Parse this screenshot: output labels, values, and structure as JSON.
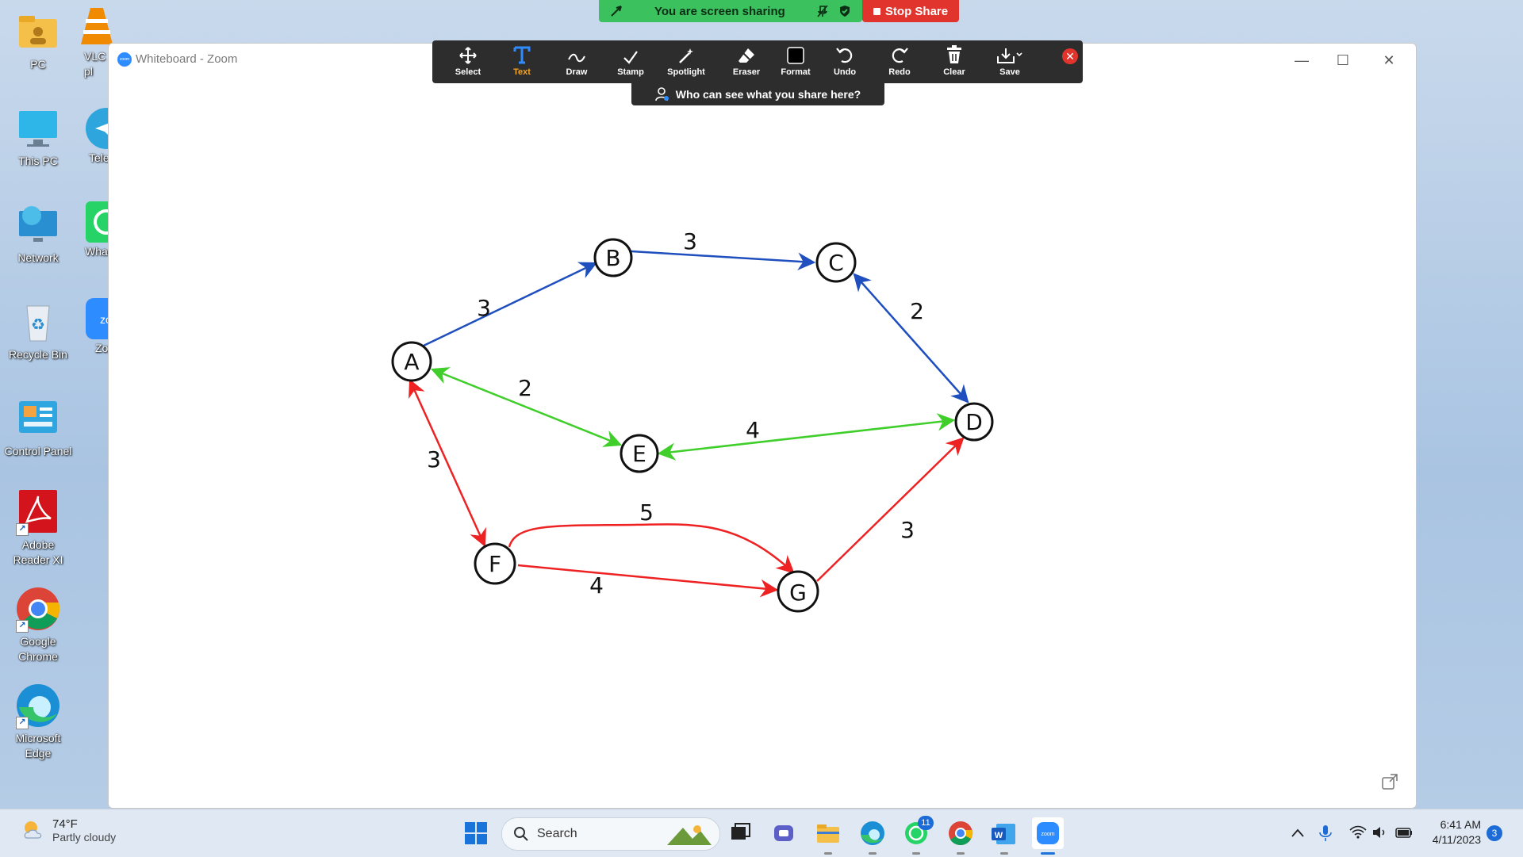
{
  "desktop": {
    "icons": [
      {
        "label": "PC"
      },
      {
        "label": "This PC"
      },
      {
        "label": "Network"
      },
      {
        "label": "Recycle Bin"
      },
      {
        "label": "Control Panel"
      },
      {
        "label": "Adobe Reader XI"
      },
      {
        "label": "Google Chrome"
      },
      {
        "label": "Microsoft Edge"
      }
    ],
    "partial_icons": [
      {
        "label": "VLC pl"
      },
      {
        "label": "Tele"
      },
      {
        "label": "Wha"
      },
      {
        "label": "Zo"
      }
    ]
  },
  "share": {
    "status": "You are screen sharing",
    "stop_label": "Stop Share"
  },
  "window": {
    "title": "Whiteboard - Zoom",
    "logo_text": "zoom"
  },
  "toolbar": {
    "tools": [
      {
        "label": "Select",
        "icon": "move-icon"
      },
      {
        "label": "Text",
        "icon": "text-icon"
      },
      {
        "label": "Draw",
        "icon": "draw-icon"
      },
      {
        "label": "Stamp",
        "icon": "check-icon"
      },
      {
        "label": "Spotlight",
        "icon": "wand-icon"
      },
      {
        "label": "Eraser",
        "icon": "eraser-icon"
      },
      {
        "label": "Format",
        "icon": "format-icon"
      },
      {
        "label": "Undo",
        "icon": "undo-icon"
      },
      {
        "label": "Redo",
        "icon": "redo-icon"
      },
      {
        "label": "Clear",
        "icon": "trash-icon"
      },
      {
        "label": "Save",
        "icon": "save-icon"
      }
    ],
    "active": "Text",
    "who_can_see": "Who can see what you share here?"
  },
  "graph": {
    "nodes": [
      "A",
      "B",
      "C",
      "D",
      "E",
      "F",
      "G"
    ],
    "edge_weights": {
      "AB": "3",
      "BC": "3",
      "CD": "2",
      "AE": "2",
      "ED": "4",
      "AF": "3",
      "FG_curve": "5",
      "FG": "4",
      "GD": "3"
    },
    "colors": {
      "blue": "#1f4fbf",
      "green": "#3fce2a",
      "red": "#ee2222"
    }
  },
  "taskbar": {
    "weather_temp": "74°F",
    "weather_desc": "Partly cloudy",
    "search_placeholder": "Search",
    "whatsapp_badge": "11",
    "time": "6:41 AM",
    "date": "4/11/2023",
    "notifications": "3"
  }
}
